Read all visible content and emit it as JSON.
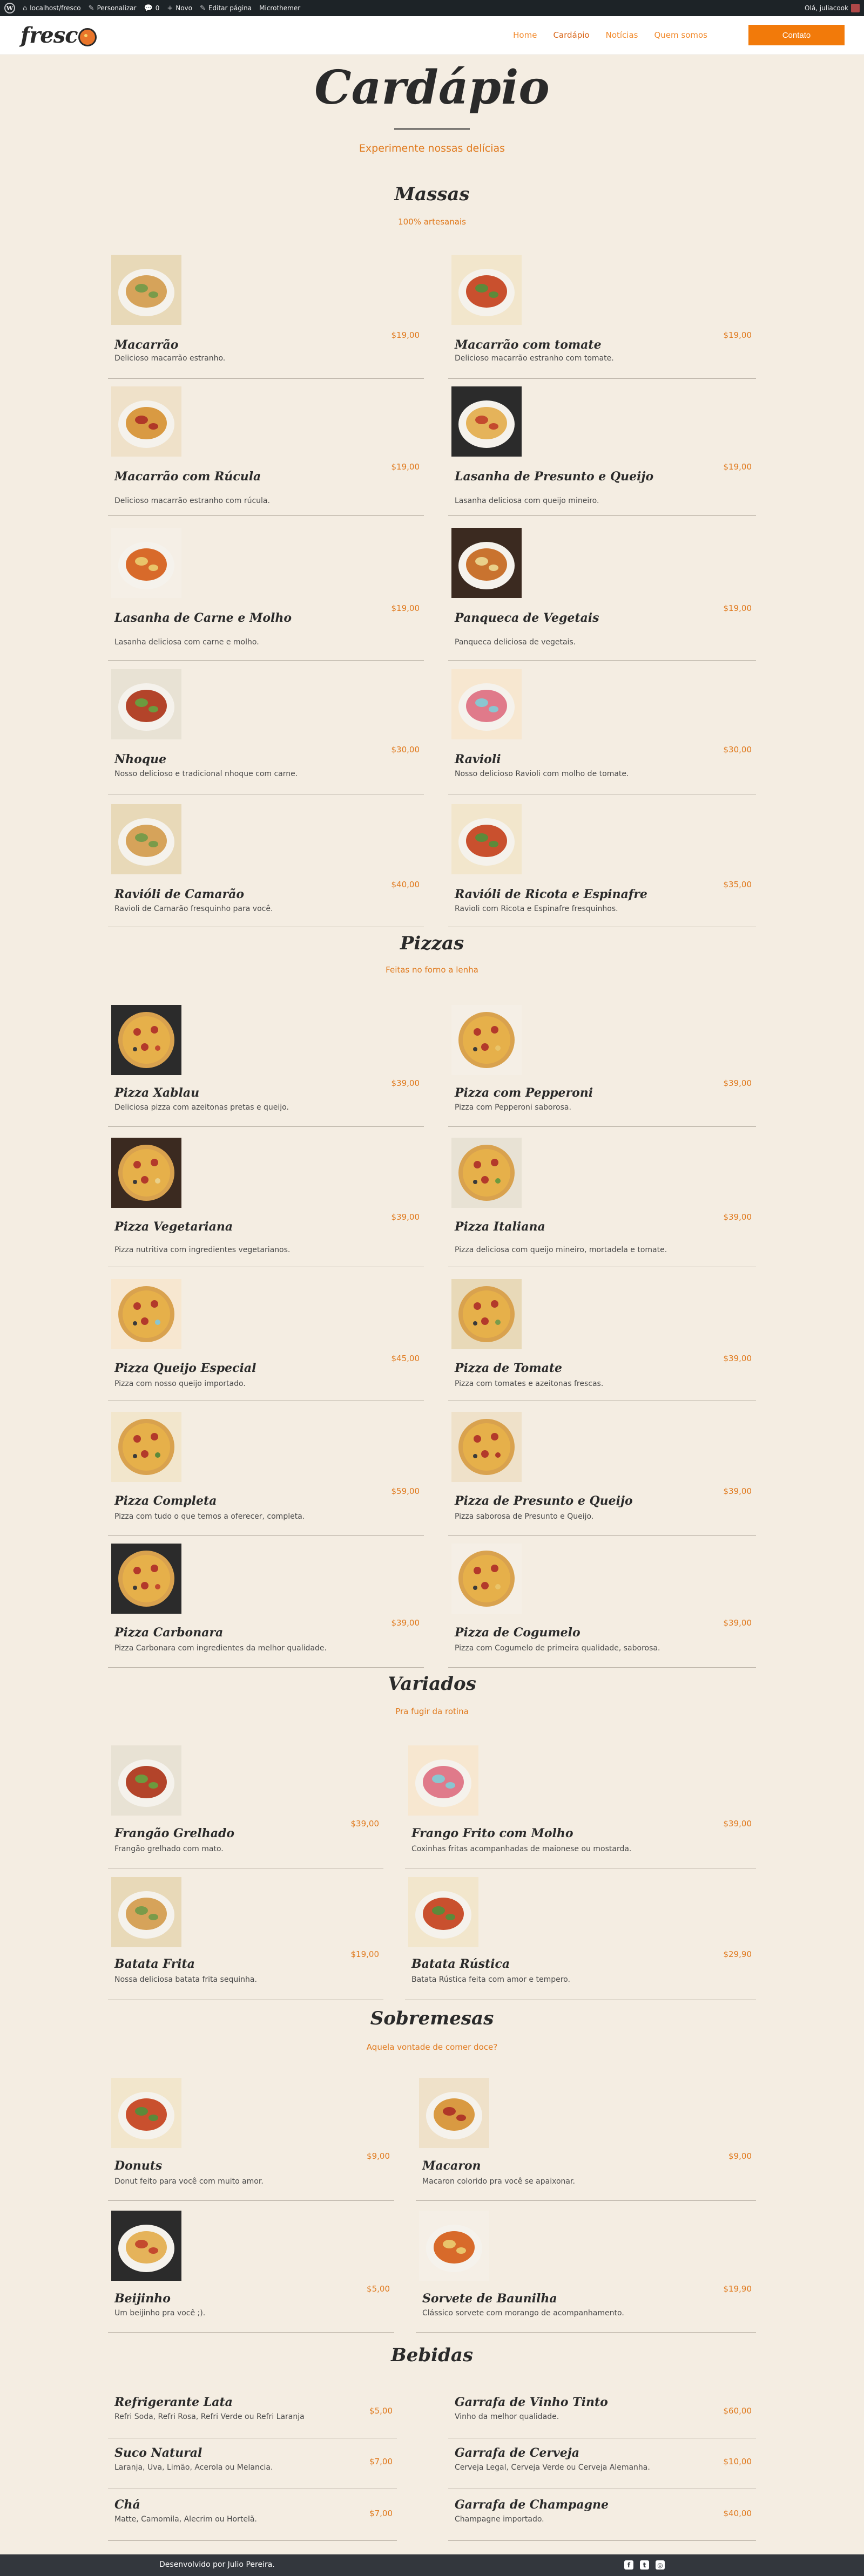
{
  "admin_bar": {
    "site": "localhost/fresco",
    "customize": "Personalizar",
    "comments": "0",
    "new": "Novo",
    "edit": "Editar página",
    "theme": "Microthemer",
    "greeting": "Olá, juliacook"
  },
  "header": {
    "logo": "fresc",
    "nav": [
      "Home",
      "Cardápio",
      "Notícias",
      "Quem somos"
    ],
    "cta": "Contato"
  },
  "hero": {
    "title": "Cardápio",
    "subtitle": "Experimente nossas delícias"
  },
  "sections": [
    {
      "title": "Massas",
      "subtitle": "100% artesanais",
      "items": [
        {
          "name": "Macarrão",
          "price": "$19,00",
          "desc": "Delicioso macarrão estranho."
        },
        {
          "name": "Macarrão com tomate",
          "price": "$19,00",
          "desc": "Delicioso macarrão estranho com tomate."
        },
        {
          "name": "Macarrão com Rúcula",
          "price": "$19,00",
          "desc": "Delicioso macarrão estranho com rúcula."
        },
        {
          "name": "Lasanha de Presunto e Queijo",
          "price": "$19,00",
          "desc": "Lasanha deliciosa com queijo mineiro."
        },
        {
          "name": "Lasanha de Carne e Molho",
          "price": "$19,00",
          "desc": "Lasanha deliciosa com carne e molho."
        },
        {
          "name": "Panqueca de Vegetais",
          "price": "$19,00",
          "desc": "Panqueca deliciosa de vegetais."
        },
        {
          "name": "Nhoque",
          "price": "$30,00",
          "desc": "Nosso delicioso e tradicional nhoque com carne."
        },
        {
          "name": "Ravioli",
          "price": "$30,00",
          "desc": "Nosso delicioso Ravioli com molho de tomate."
        },
        {
          "name": "Ravióli de Camarão",
          "price": "$40,00",
          "desc": "Ravioli de Camarão fresquinho para você."
        },
        {
          "name": "Ravióli de Ricota e Espinafre",
          "price": "$35,00",
          "desc": "Ravioli com Ricota e Espinafre fresquinhos."
        }
      ]
    },
    {
      "title": "Pizzas",
      "subtitle": "Feitas no forno a lenha",
      "items": [
        {
          "name": "Pizza Xablau",
          "price": "$39,00",
          "desc": "Deliciosa pizza com azeitonas pretas e queijo."
        },
        {
          "name": "Pizza com Pepperoni",
          "price": "$39,00",
          "desc": "Pizza com Pepperoni saborosa."
        },
        {
          "name": "Pizza Vegetariana",
          "price": "$39,00",
          "desc": "Pizza nutritiva com ingredientes vegetarianos."
        },
        {
          "name": "Pizza Italiana",
          "price": "$39,00",
          "desc": "Pizza deliciosa com queijo mineiro, mortadela e tomate."
        },
        {
          "name": "Pizza Queijo Especial",
          "price": "$45,00",
          "desc": "Pizza com nosso queijo importado."
        },
        {
          "name": "Pizza de Tomate",
          "price": "$39,00",
          "desc": "Pizza com tomates e azeitonas frescas."
        },
        {
          "name": "Pizza Completa",
          "price": "$59,00",
          "desc": "Pizza com tudo o que temos a oferecer, completa."
        },
        {
          "name": "Pizza de Presunto e Queijo",
          "price": "$39,00",
          "desc": "Pizza saborosa de Presunto e Queijo."
        },
        {
          "name": "Pizza Carbonara",
          "price": "$39,00",
          "desc": "Pizza Carbonara com ingredientes da melhor qualidade."
        },
        {
          "name": "Pizza de Cogumelo",
          "price": "$39,00",
          "desc": "Pizza com Cogumelo de primeira qualidade, saborosa."
        }
      ]
    },
    {
      "title": "Variados",
      "subtitle": "Pra fugir da rotina",
      "items": [
        {
          "name": "Frangão Grelhado",
          "price": "$39,00",
          "desc": "Frangão grelhado com mato."
        },
        {
          "name": "Frango Frito com Molho",
          "price": "$39,00",
          "desc": "Coxinhas fritas acompanhadas de maionese ou mostarda."
        },
        {
          "name": "Batata Frita",
          "price": "$19,00",
          "desc": "Nossa deliciosa batata frita sequinha."
        },
        {
          "name": "Batata Rústica",
          "price": "$29,90",
          "desc": "Batata Rústica feita com amor e tempero."
        }
      ]
    },
    {
      "title": "Sobremesas",
      "subtitle": "Aquela vontade de comer doce?",
      "items": [
        {
          "name": "Donuts",
          "price": "$9,00",
          "desc": "Donut feito para você com muito amor."
        },
        {
          "name": "Macaron",
          "price": "$9,00",
          "desc": "Macaron colorido pra você se apaixonar."
        },
        {
          "name": "Beijinho",
          "price": "$5,00",
          "desc": "Um beijinho pra você ;)."
        },
        {
          "name": "Sorvete de Baunilha",
          "price": "$19,90",
          "desc": "Clássico sorvete com morango de acompanhamento."
        }
      ]
    },
    {
      "title": "Bebidas",
      "items": [
        {
          "name": "Refrigerante Lata",
          "price": "$5,00",
          "desc": "Refri Soda, Refri Rosa, Refri Verde ou Refri Laranja"
        },
        {
          "name": "Garrafa de Vinho Tinto",
          "price": "$60,00",
          "desc": "Vinho da melhor qualidade."
        },
        {
          "name": "Suco Natural",
          "price": "$7,00",
          "desc": "Laranja, Uva, Limão, Acerola ou Melancia."
        },
        {
          "name": "Garrafa de Cerveja",
          "price": "$10,00",
          "desc": "Cerveja Legal, Cerveja Verde ou Cerveja Alemanha."
        },
        {
          "name": "Chá",
          "price": "$7,00",
          "desc": "Matte, Camomila, Alecrim ou Hortelã."
        },
        {
          "name": "Garrafa de Champagne",
          "price": "$40,00",
          "desc": "Champagne importado."
        }
      ]
    }
  ],
  "footer": {
    "credit": "Desenvolvido por Julio Pereira.",
    "socials": [
      "facebook-icon",
      "twitter-icon",
      "instagram-icon"
    ]
  },
  "colors": {
    "background": "#f4ede2",
    "accent": "#e07a1e",
    "cta": "#f27a0a",
    "admin_bar": "#1d2327",
    "footer": "#33373d"
  }
}
